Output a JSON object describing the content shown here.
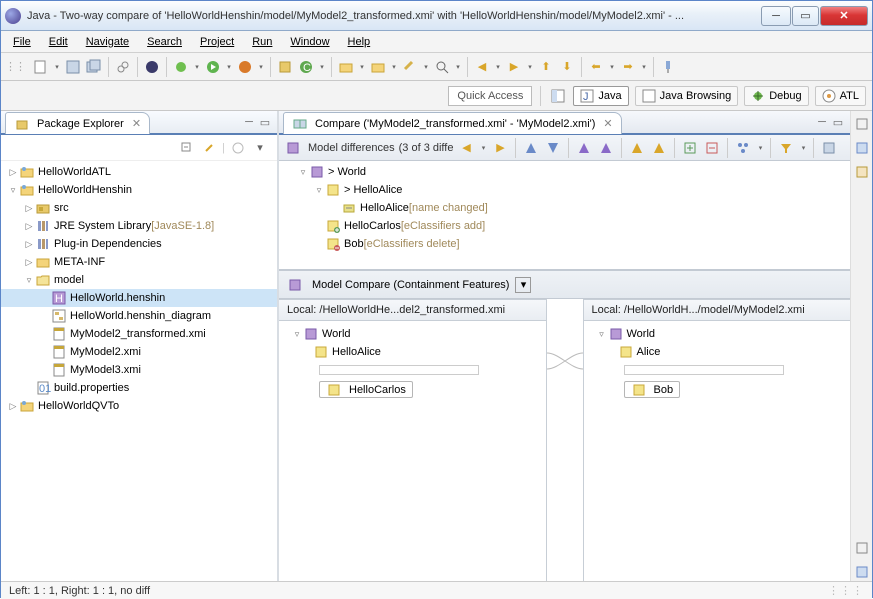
{
  "window": {
    "title": "Java - Two-way compare of 'HelloWorldHenshin/model/MyModel2_transformed.xmi' with 'HelloWorldHenshin/model/MyModel2.xmi' - ..."
  },
  "menu": {
    "items": [
      "File",
      "Edit",
      "Navigate",
      "Search",
      "Project",
      "Run",
      "Window",
      "Help"
    ]
  },
  "quick_access": {
    "placeholder": "Quick Access"
  },
  "perspectives": {
    "items": [
      {
        "label": "Java",
        "active": true
      },
      {
        "label": "Java Browsing",
        "active": false
      },
      {
        "label": "Debug",
        "active": false
      },
      {
        "label": "ATL",
        "active": false
      }
    ]
  },
  "package_explorer": {
    "tab_label": "Package Explorer",
    "nodes": [
      {
        "indent": 0,
        "exp": "▷",
        "icon": "project",
        "label": "HelloWorldATL"
      },
      {
        "indent": 0,
        "exp": "▿",
        "icon": "project",
        "label": "HelloWorldHenshin"
      },
      {
        "indent": 1,
        "exp": "▷",
        "icon": "srcfolder",
        "label": "src"
      },
      {
        "indent": 1,
        "exp": "▷",
        "icon": "library",
        "label": "JRE System Library",
        "decor": "[JavaSE-1.8]"
      },
      {
        "indent": 1,
        "exp": "▷",
        "icon": "library",
        "label": "Plug-in Dependencies"
      },
      {
        "indent": 1,
        "exp": "▷",
        "icon": "folder",
        "label": "META-INF"
      },
      {
        "indent": 1,
        "exp": "▿",
        "icon": "folder-open",
        "label": "model"
      },
      {
        "indent": 2,
        "exp": "",
        "icon": "henshin",
        "label": "HelloWorld.henshin",
        "selected": true
      },
      {
        "indent": 2,
        "exp": "",
        "icon": "diagram",
        "label": "HelloWorld.henshin_diagram"
      },
      {
        "indent": 2,
        "exp": "",
        "icon": "xmi",
        "label": "MyModel2_transformed.xmi"
      },
      {
        "indent": 2,
        "exp": "",
        "icon": "xmi",
        "label": "MyModel2.xmi"
      },
      {
        "indent": 2,
        "exp": "",
        "icon": "xmi",
        "label": "MyModel3.xmi"
      },
      {
        "indent": 1,
        "exp": "",
        "icon": "file",
        "label": "build.properties"
      },
      {
        "indent": 0,
        "exp": "▷",
        "icon": "project",
        "label": "HelloWorldQVTo"
      }
    ]
  },
  "compare": {
    "tab_label": "Compare ('MyModel2_transformed.xmi' - 'MyModel2.xmi')",
    "diff_toolbar_label": "Model differences",
    "diff_count": "(3 of 3 diffe",
    "diff_tree": [
      {
        "indent": 0,
        "exp": "▿",
        "icon": "package",
        "label": "> World"
      },
      {
        "indent": 1,
        "exp": "▿",
        "icon": "class",
        "label": "> HelloAlice"
      },
      {
        "indent": 2,
        "exp": "",
        "icon": "attr",
        "label": "HelloAlice",
        "decor": "[name changed]"
      },
      {
        "indent": 1,
        "exp": "",
        "icon": "class-add",
        "label": "HelloCarlos",
        "decor": "[eClassifiers add]"
      },
      {
        "indent": 1,
        "exp": "",
        "icon": "class-del",
        "label": "Bob",
        "decor": "[eClassifiers delete]"
      }
    ],
    "model_compare_title": "Model Compare (Containment Features)",
    "local_left": "Local: /HelloWorldHe...del2_transformed.xmi",
    "local_right": "Local: /HelloWorldH.../model/MyModel2.xmi",
    "left_tree": {
      "root": "World",
      "child1": "HelloAlice",
      "child2": "HelloCarlos"
    },
    "right_tree": {
      "root": "World",
      "child1": "Alice",
      "child2": "Bob"
    }
  },
  "status": "Left: 1 : 1, Right: 1 : 1, no diff"
}
